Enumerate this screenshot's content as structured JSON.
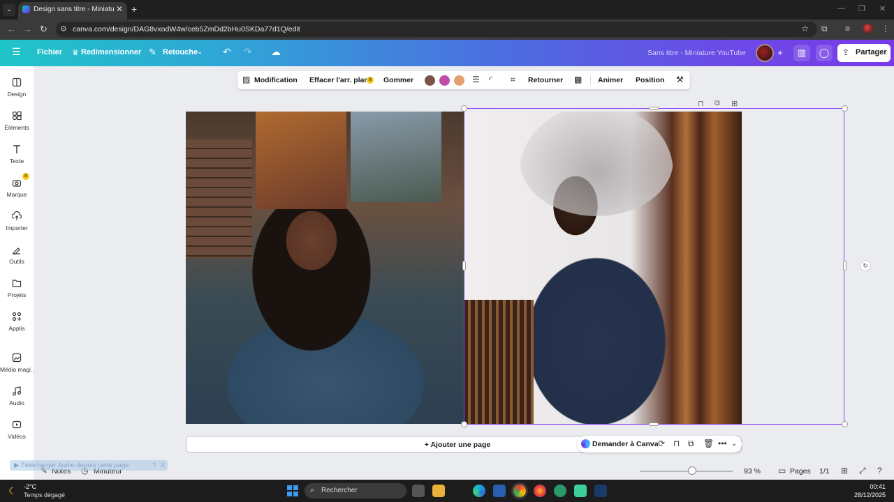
{
  "browser": {
    "tab_title": "Design sans titre - Miniature YouTube",
    "new_tab_symbol": "+",
    "close_symbol": "✕",
    "url": "canva.com/design/DAG8vxodW4w/ceb5ZmDd2bHu0SKDa77d1Q/edit"
  },
  "header": {
    "menu_label": "Fichier",
    "resize_label": "Redimensionner",
    "edit_mode_label": "Retouche",
    "doc_title": "Sans titre - Miniature YouTube",
    "share_label": "Partager"
  },
  "sidebar": {
    "items": [
      {
        "label": "Design",
        "icon": "design-icon"
      },
      {
        "label": "Éléments",
        "icon": "elements-icon"
      },
      {
        "label": "Texte",
        "icon": "text-icon"
      },
      {
        "label": "Marque",
        "icon": "brand-icon"
      },
      {
        "label": "Importer",
        "icon": "upload-icon"
      },
      {
        "label": "Outils",
        "icon": "tools-icon"
      },
      {
        "label": "Projets",
        "icon": "folder-icon"
      },
      {
        "label": "Applis",
        "icon": "apps-icon"
      },
      {
        "label": "Média magi...",
        "icon": "magic-media-icon"
      },
      {
        "label": "Audio",
        "icon": "audio-icon"
      },
      {
        "label": "Vidéos",
        "icon": "video-icon"
      }
    ]
  },
  "context_toolbar": {
    "edit_label": "Modification",
    "remove_bg_label": "Effacer l'arr. plan",
    "erase_label": "Gommer",
    "flip_label": "Retourner",
    "animate_label": "Animer",
    "position_label": "Position",
    "swatches": [
      "#7a5448",
      "#c04aa8",
      "#e4a070"
    ]
  },
  "canvas": {
    "add_page_label": "+ Ajouter une page",
    "ask_canva_label": "Demander à Canva"
  },
  "overlay": {
    "audio_download_label": "▶ Télécharger Audio depuis cette page",
    "help_symbol": "?",
    "close_symbol": "X"
  },
  "status": {
    "notes_label": "Notes",
    "timer_label": "Minuteur",
    "zoom_label": "93 %",
    "zoom_value": 0.52,
    "pages_label": "Pages",
    "page_counter": "1/1"
  },
  "taskbar": {
    "temperature": "-2°C",
    "weather": "Temps dégagé",
    "search_label": "Rechercher",
    "time": "00:41",
    "date": "28/12/2025"
  },
  "colors": {
    "brand_gradient_start": "#1fc5c9",
    "brand_gradient_end": "#7a3ae8",
    "selection": "#8b3dff"
  }
}
